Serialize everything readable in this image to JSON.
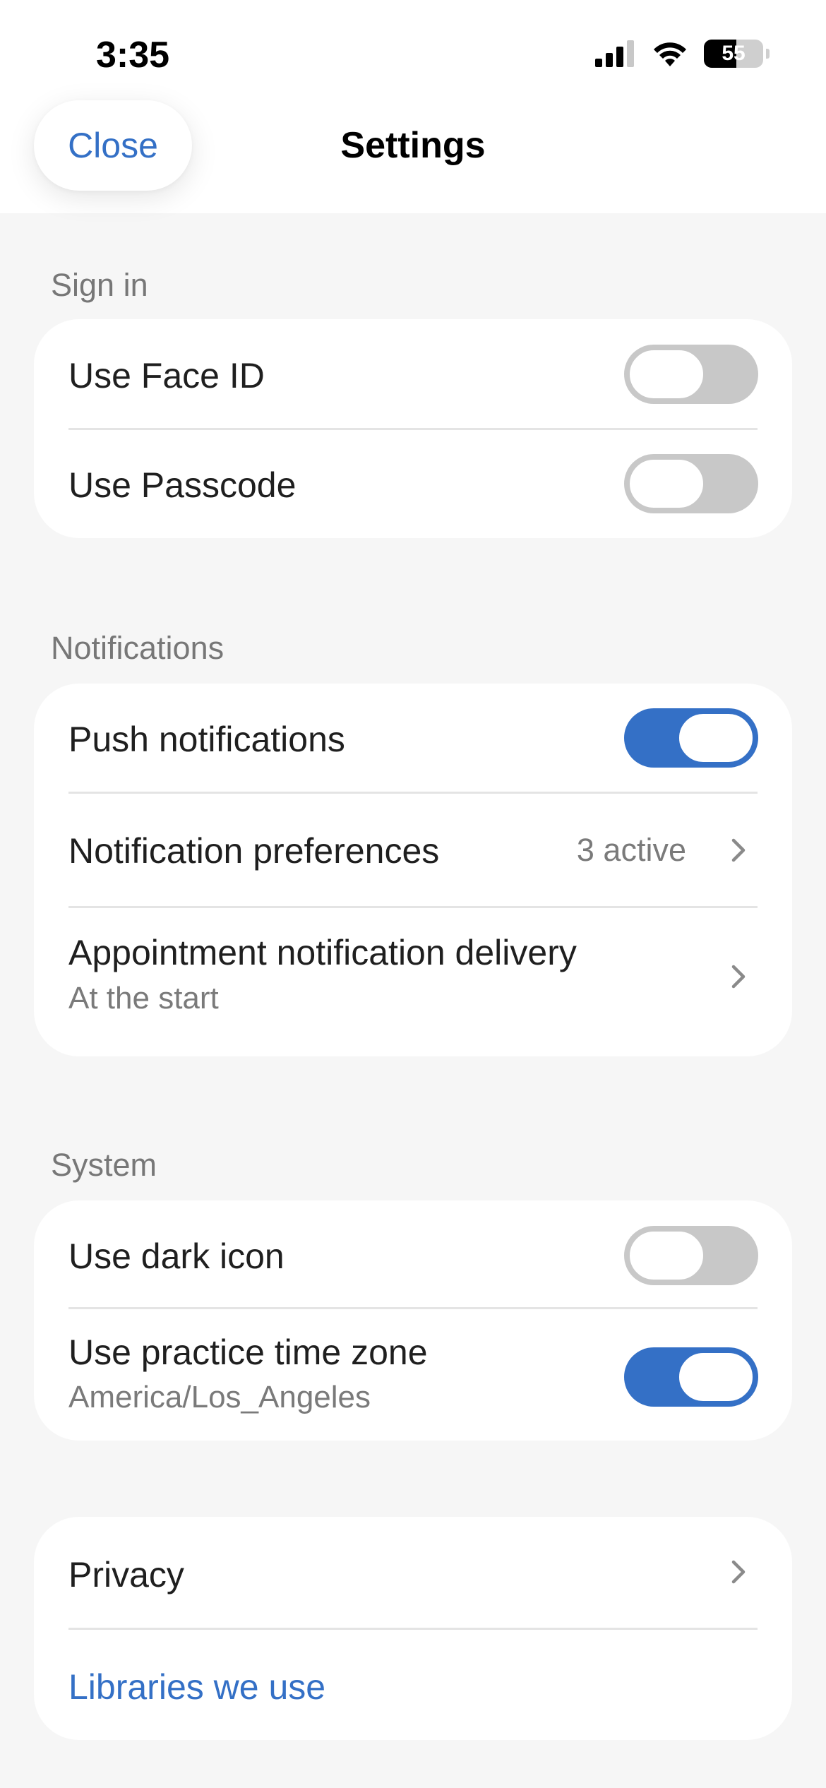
{
  "status_bar": {
    "time": "3:35",
    "battery_level": "55",
    "icons": [
      "cellular-signal-icon",
      "wifi-icon",
      "battery-icon"
    ]
  },
  "header": {
    "close_label": "Close",
    "title": "Settings"
  },
  "colors": {
    "accent": "#3470c6",
    "toggle_off": "#c8c8c8",
    "background": "#f6f6f6",
    "card": "#ffffff",
    "secondary_text": "#7a7a7a"
  },
  "sign_in": {
    "label": "Sign in",
    "face_id": {
      "label": "Use Face ID",
      "enabled": false
    },
    "passcode": {
      "label": "Use Passcode",
      "enabled": false
    }
  },
  "notifications": {
    "label": "Notifications",
    "push": {
      "label": "Push notifications",
      "enabled": true
    },
    "preferences": {
      "label": "Notification preferences",
      "value": "3 active",
      "icon": "chevron-right-icon"
    },
    "appointment_delivery": {
      "label": "Appointment notification delivery",
      "value": "At the start",
      "icon": "chevron-right-icon"
    }
  },
  "system": {
    "label": "System",
    "dark_icon": {
      "label": "Use dark icon",
      "enabled": false
    },
    "practice_time_zone": {
      "label": "Use practice time zone",
      "value": "America/Los_Angeles",
      "enabled": true
    }
  },
  "about": {
    "privacy": {
      "label": "Privacy",
      "icon": "chevron-right-icon"
    },
    "libraries": {
      "label": "Libraries we use"
    }
  }
}
